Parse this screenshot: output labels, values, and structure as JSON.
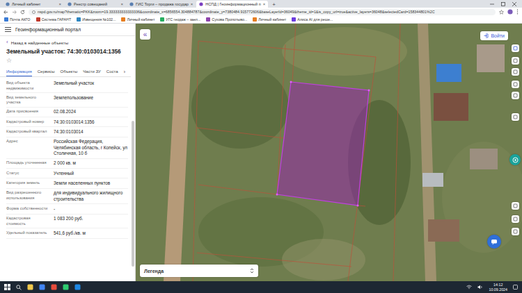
{
  "browser": {
    "tabs": [
      {
        "label": "Личный кабинет",
        "selected": false
      },
      {
        "label": "Реестр совещаний",
        "selected": false
      },
      {
        "label": "ГИС Торги – продажа государ",
        "selected": false
      },
      {
        "label": "НСПД | Геоинформационный п",
        "selected": true
      }
    ],
    "new_tab": "+",
    "close": "×",
    "address": "nspd.gov.ru/map?thematic=PKK&zoom=19.333333333333336&coordinate_x=6856554.304884787&coordinate_y=7380484.915772606&baseLayerId=36049&theme_id=1&is_copy_url=true&active_layers=36048&selectedCard=158344801%2C",
    "bookmarks": [
      "Почта АКГО",
      "Система ГАРАНТ",
      "Извещения №102...",
      "Личный кабинет",
      "УГС геодаж – заел...",
      "Сухова Пропотыво...",
      "Личный кабинет",
      "Алиса AI для реше..."
    ]
  },
  "portal": {
    "title": "Геоинформационный портал"
  },
  "panel": {
    "back_arrow": "‹",
    "back": "Назад в найденные объекты",
    "title": "Земельный участок: 74:30:0103014:1356",
    "star": "☆",
    "tabs": [
      {
        "label": "Информация",
        "selected": true
      },
      {
        "label": "Сервисы",
        "selected": false
      },
      {
        "label": "Объекты",
        "selected": false
      },
      {
        "label": "Части ЗУ",
        "selected": false
      },
      {
        "label": "Соста",
        "selected": false
      }
    ],
    "tabs_more": "›",
    "fields": [
      {
        "label": "Вид объекта недвижимости",
        "value": "Земельный участок"
      },
      {
        "label": "Вид земельного участка",
        "value": "Землепользование"
      },
      {
        "label": "Дата присвоения",
        "value": "02.08.2024"
      },
      {
        "label": "Кадастровый номер",
        "value": "74:30:0103014:1356"
      },
      {
        "label": "Кадастровый квартал",
        "value": "74:30:0103014"
      },
      {
        "label": "Адрес",
        "value": "Российская Федерация, Челябинская область, г Копейск, ул Столичная, 10 б"
      },
      {
        "label": "Площадь уточненная",
        "value": "2 000 кв. м"
      },
      {
        "label": "Статус",
        "value": "Учтенный"
      },
      {
        "label": "Категория земель",
        "value": "Земли населенных пунктов"
      },
      {
        "label": "Вид разрешенного использования",
        "value": "для индивидуального жилищного строительства"
      },
      {
        "label": "Форма собственности",
        "value": "-"
      },
      {
        "label": "Кадастровая стоимость",
        "value": "1 083 200 руб."
      },
      {
        "label": "Удельный показатель",
        "value": "541,6 руб./кв. м"
      }
    ]
  },
  "map": {
    "collapse": "«",
    "login": "Войти",
    "legend": "Легенда"
  },
  "taskbar": {
    "time": "14:12",
    "date": "10.09.2024"
  }
}
